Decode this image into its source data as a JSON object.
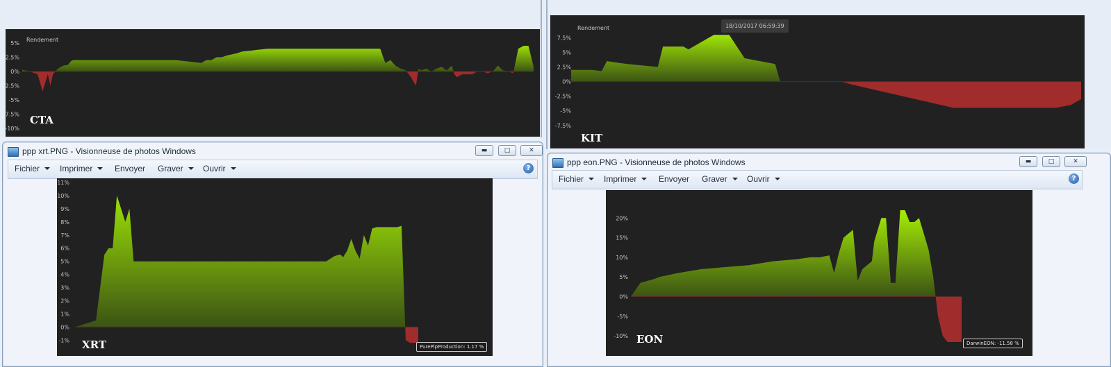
{
  "colors": {
    "background": "#212121",
    "positive_top": "#a6ee05",
    "positive_bottom": "#3c5414",
    "negative": "#b32d2d"
  },
  "window_xrt": {
    "title": "ppp xrt.PNG - Visionneuse de photos Windows",
    "menu": [
      "Fichier",
      "Imprimer",
      "Envoyer",
      "Graver",
      "Ouvrir"
    ],
    "icons": {
      "app": "photo-viewer-icon",
      "help": "help-icon",
      "minimize": "minimize-icon",
      "maximize": "maximize-icon",
      "close": "close-icon"
    }
  },
  "window_eon": {
    "title": "ppp eon.PNG - Visionneuse de photos Windows",
    "menu": [
      "Fichier",
      "Imprimer",
      "Envoyer",
      "Graver",
      "Ouvrir"
    ],
    "icons": {
      "app": "photo-viewer-icon",
      "help": "help-icon",
      "minimize": "minimize-icon",
      "maximize": "maximize-icon",
      "close": "close-icon"
    }
  },
  "chart_data": [
    {
      "id": "cta",
      "type": "area",
      "name": "CTA",
      "title": "Rendement",
      "yticks": [
        "5%",
        "2.5%",
        "0%",
        "-2.5%",
        "-5%",
        "-7.5%",
        "-10%"
      ],
      "ylim": [
        -10,
        5
      ],
      "x": [
        0,
        1.5,
        3,
        4,
        5,
        5.5,
        6,
        7,
        8,
        9,
        9.5,
        10,
        11,
        12,
        13,
        14,
        16,
        18,
        20,
        25,
        30,
        35,
        36,
        37,
        38,
        39,
        40,
        41,
        42,
        43,
        44,
        45,
        46,
        47,
        48,
        50,
        52,
        54,
        56,
        58,
        60,
        65,
        70,
        71,
        72,
        73,
        74,
        75,
        76,
        77,
        77.5,
        78,
        79,
        80,
        81,
        82,
        83,
        84,
        84.5,
        85,
        86,
        87,
        88,
        89,
        90,
        91,
        92,
        93,
        94,
        95,
        96,
        97,
        98,
        99,
        100
      ],
      "values": [
        0.3,
        0,
        -0.5,
        -3.5,
        -0.5,
        -2.5,
        -0.5,
        0.5,
        1,
        1.2,
        1.8,
        2,
        2,
        2,
        2,
        2,
        2,
        2,
        2,
        2,
        2,
        1.5,
        2,
        2,
        2.5,
        2.5,
        2.8,
        3,
        3.2,
        3.5,
        3.6,
        3.7,
        3.8,
        3.9,
        4,
        4,
        4,
        4,
        4,
        4,
        4,
        4,
        4,
        1.5,
        2,
        1,
        0.5,
        0.2,
        -1,
        -2.5,
        0.5,
        0.2,
        0.5,
        0,
        0.5,
        0.8,
        0.2,
        1,
        -0.5,
        -1,
        -0.5,
        -0.5,
        -0.5,
        0,
        0,
        -0.3,
        0,
        1,
        0.2,
        0,
        -0.3,
        4,
        4.5,
        4.5,
        0.8,
        1
      ],
      "grid": false
    },
    {
      "id": "kit",
      "type": "area",
      "name": "KIT",
      "title": "Rendement",
      "tooltip": "18/10/2017 06:59:39",
      "yticks": [
        "7.5%",
        "5%",
        "2.5%",
        "0%",
        "-2.5%",
        "-5%",
        "-7.5%"
      ],
      "ylim": [
        -8,
        8.5
      ],
      "x": [
        0,
        4,
        6,
        7,
        11,
        17,
        18,
        22,
        23,
        28,
        31,
        34,
        37,
        40,
        41,
        43,
        46,
        53,
        55,
        75,
        78,
        80,
        82,
        85,
        90,
        95,
        98,
        100
      ],
      "values": [
        2,
        2,
        1.8,
        3.5,
        3,
        2.5,
        6,
        6,
        5.5,
        8,
        8,
        4,
        3.5,
        3,
        0,
        0,
        0,
        0,
        -0.5,
        -4.5,
        -4.5,
        -4.5,
        -4.5,
        -4.5,
        -4.5,
        -4.5,
        -4,
        -3
      ],
      "grid": false
    },
    {
      "id": "xrt",
      "type": "area",
      "name": "XRT",
      "tooltip": "PurePipProduction: 1.17 %",
      "yticks": [
        "11%",
        "10%",
        "9%",
        "8%",
        "7%",
        "6%",
        "5%",
        "4%",
        "3%",
        "2%",
        "1%",
        "0%",
        "-1%"
      ],
      "ylim": [
        -1.3,
        11
      ],
      "x": [
        0,
        5,
        7,
        8,
        9,
        10,
        11,
        12,
        13,
        14,
        15,
        16,
        17,
        18,
        60,
        61,
        62,
        63,
        63.5,
        64,
        65,
        66,
        67,
        68,
        69,
        70,
        71,
        72,
        73,
        76,
        77,
        78,
        79,
        80,
        81,
        82
      ],
      "values": [
        0,
        0.5,
        5.5,
        6,
        6,
        10,
        9,
        8,
        9,
        5,
        5,
        5,
        5,
        5,
        5,
        5.2,
        5.4,
        5.5,
        5.5,
        5.3,
        5.8,
        6.7,
        5.8,
        5.2,
        7,
        6.2,
        7.5,
        7.6,
        7.6,
        7.6,
        7.6,
        7.7,
        -1,
        -1.2,
        -1.2,
        -1.2
      ],
      "grid": false
    },
    {
      "id": "eon",
      "type": "area",
      "name": "EON",
      "tooltip": "DarwinEON: -11.58 %",
      "yticks": [
        "20%",
        "15%",
        "10%",
        "5%",
        "0%",
        "-5%",
        "-10%"
      ],
      "ylim": [
        -11.58,
        22
      ],
      "x": [
        0,
        2,
        5,
        6,
        10,
        15,
        20,
        25,
        30,
        35,
        38,
        40,
        42,
        43,
        44,
        45,
        46,
        47,
        48,
        49,
        50,
        51,
        51.5,
        52,
        53,
        54,
        55,
        56,
        57,
        58,
        59,
        60,
        61,
        62,
        63,
        64,
        65,
        66,
        67,
        68,
        69,
        70
      ],
      "values": [
        0,
        3.5,
        4.5,
        5,
        6,
        7,
        7.5,
        8,
        9,
        9.5,
        10,
        10,
        10.5,
        6,
        11,
        15,
        16,
        17,
        4,
        7,
        8,
        9,
        14,
        16,
        20,
        20,
        3.5,
        3.5,
        22,
        22,
        19,
        19,
        20,
        16,
        12,
        5,
        -5,
        -10,
        -11.58,
        -11.58,
        -11.58,
        -11.58
      ],
      "grid": false
    }
  ]
}
